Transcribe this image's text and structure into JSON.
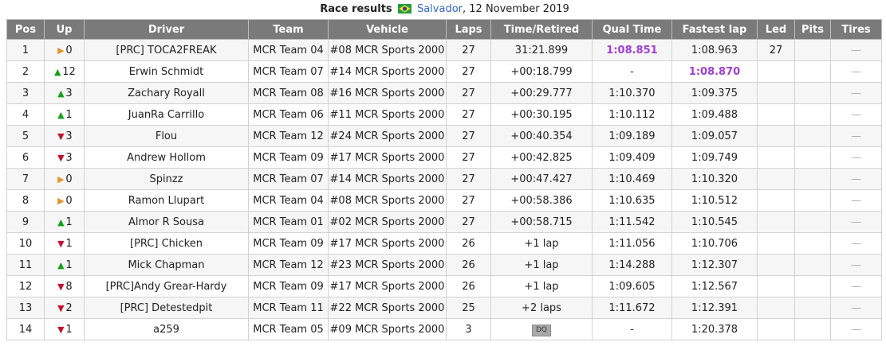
{
  "caption": {
    "title": "Race results",
    "location": "Salvador",
    "date": ", 12 November 2019"
  },
  "headers": [
    "Pos",
    "Up",
    "Driver",
    "Team",
    "Vehicle",
    "Laps",
    "Time/Retired",
    "Qual Time",
    "Fastest lap",
    "Led",
    "Pits",
    "Tires"
  ],
  "rows": [
    {
      "pos": "1",
      "dir": "same",
      "up": "0",
      "driver": "[PRC] TOCA2FREAK",
      "team": "MCR Team 04",
      "vehicle": "#08 MCR Sports 2000",
      "laps": "27",
      "time": "31:21.899",
      "qual": "1:08.851",
      "qual_best": true,
      "fastest": "1:08.963",
      "fastest_best": false,
      "led": "27",
      "pits": "",
      "tires": "—",
      "dq": false
    },
    {
      "pos": "2",
      "dir": "up",
      "up": "12",
      "driver": "Erwin Schmidt",
      "team": "MCR Team 07",
      "vehicle": "#14 MCR Sports 2000",
      "laps": "27",
      "time": "+00:18.799",
      "qual": "-",
      "qual_best": false,
      "fastest": "1:08.870",
      "fastest_best": true,
      "led": "",
      "pits": "",
      "tires": "—",
      "dq": false
    },
    {
      "pos": "3",
      "dir": "up",
      "up": "3",
      "driver": "Zachary Royall",
      "team": "MCR Team 08",
      "vehicle": "#16 MCR Sports 2000",
      "laps": "27",
      "time": "+00:29.777",
      "qual": "1:10.370",
      "qual_best": false,
      "fastest": "1:09.375",
      "fastest_best": false,
      "led": "",
      "pits": "",
      "tires": "—",
      "dq": false
    },
    {
      "pos": "4",
      "dir": "up",
      "up": "1",
      "driver": "JuanRa Carrillo",
      "team": "MCR Team 06",
      "vehicle": "#11 MCR Sports 2000",
      "laps": "27",
      "time": "+00:30.195",
      "qual": "1:10.112",
      "qual_best": false,
      "fastest": "1:09.488",
      "fastest_best": false,
      "led": "",
      "pits": "",
      "tires": "—",
      "dq": false
    },
    {
      "pos": "5",
      "dir": "down",
      "up": "3",
      "driver": "Flou",
      "team": "MCR Team 12",
      "vehicle": "#24 MCR Sports 2000",
      "laps": "27",
      "time": "+00:40.354",
      "qual": "1:09.189",
      "qual_best": false,
      "fastest": "1:09.057",
      "fastest_best": false,
      "led": "",
      "pits": "",
      "tires": "—",
      "dq": false
    },
    {
      "pos": "6",
      "dir": "down",
      "up": "3",
      "driver": "Andrew Hollom",
      "team": "MCR Team 09",
      "vehicle": "#17 MCR Sports 2000",
      "laps": "27",
      "time": "+00:42.825",
      "qual": "1:09.409",
      "qual_best": false,
      "fastest": "1:09.749",
      "fastest_best": false,
      "led": "",
      "pits": "",
      "tires": "—",
      "dq": false
    },
    {
      "pos": "7",
      "dir": "same",
      "up": "0",
      "driver": "Spinzz",
      "team": "MCR Team 07",
      "vehicle": "#14 MCR Sports 2000",
      "laps": "27",
      "time": "+00:47.427",
      "qual": "1:10.469",
      "qual_best": false,
      "fastest": "1:10.320",
      "fastest_best": false,
      "led": "",
      "pits": "",
      "tires": "—",
      "dq": false
    },
    {
      "pos": "8",
      "dir": "same",
      "up": "0",
      "driver": "Ramon Llupart",
      "team": "MCR Team 04",
      "vehicle": "#08 MCR Sports 2000",
      "laps": "27",
      "time": "+00:58.386",
      "qual": "1:10.635",
      "qual_best": false,
      "fastest": "1:10.512",
      "fastest_best": false,
      "led": "",
      "pits": "",
      "tires": "—",
      "dq": false
    },
    {
      "pos": "9",
      "dir": "up",
      "up": "1",
      "driver": "Almor R Sousa",
      "team": "MCR Team 01",
      "vehicle": "#02 MCR Sports 2000",
      "laps": "27",
      "time": "+00:58.715",
      "qual": "1:11.542",
      "qual_best": false,
      "fastest": "1:10.545",
      "fastest_best": false,
      "led": "",
      "pits": "",
      "tires": "—",
      "dq": false
    },
    {
      "pos": "10",
      "dir": "down",
      "up": "1",
      "driver": "[PRC] Chicken",
      "team": "MCR Team 09",
      "vehicle": "#17 MCR Sports 2000",
      "laps": "26",
      "time": "+1 lap",
      "qual": "1:11.056",
      "qual_best": false,
      "fastest": "1:10.706",
      "fastest_best": false,
      "led": "",
      "pits": "",
      "tires": "—",
      "dq": false
    },
    {
      "pos": "11",
      "dir": "up",
      "up": "1",
      "driver": "Mick Chapman",
      "team": "MCR Team 12",
      "vehicle": "#23 MCR Sports 2000",
      "laps": "26",
      "time": "+1 lap",
      "qual": "1:14.288",
      "qual_best": false,
      "fastest": "1:12.307",
      "fastest_best": false,
      "led": "",
      "pits": "",
      "tires": "—",
      "dq": false
    },
    {
      "pos": "12",
      "dir": "down",
      "up": "8",
      "driver": "[PRC]Andy Grear-Hardy",
      "team": "MCR Team 09",
      "vehicle": "#17 MCR Sports 2000",
      "laps": "26",
      "time": "+1 lap",
      "qual": "1:09.605",
      "qual_best": false,
      "fastest": "1:12.567",
      "fastest_best": false,
      "led": "",
      "pits": "",
      "tires": "—",
      "dq": false
    },
    {
      "pos": "13",
      "dir": "down",
      "up": "2",
      "driver": "[PRC] Detestedpit",
      "team": "MCR Team 11",
      "vehicle": "#22 MCR Sports 2000",
      "laps": "25",
      "time": "+2 laps",
      "qual": "1:11.672",
      "qual_best": false,
      "fastest": "1:12.391",
      "fastest_best": false,
      "led": "",
      "pits": "",
      "tires": "—",
      "dq": false
    },
    {
      "pos": "14",
      "dir": "down",
      "up": "1",
      "driver": "a259",
      "team": "MCR Team 05",
      "vehicle": "#09 MCR Sports 2000",
      "laps": "3",
      "time": "DQ",
      "qual": "-",
      "qual_best": false,
      "fastest": "1:20.378",
      "fastest_best": false,
      "led": "",
      "pits": "",
      "tires": "—",
      "dq": true
    }
  ],
  "colors": {
    "header_bg": "#7a7a7a",
    "best_time": "#a33dd1",
    "arrow_up": "#17a317",
    "arrow_down": "#c8102e",
    "arrow_same": "#e8922f",
    "link": "#3366cc"
  },
  "icons": {
    "flag": "brazil-flag-icon",
    "up": "triangle-up-icon",
    "down": "triangle-down-icon",
    "same": "triangle-right-icon"
  }
}
